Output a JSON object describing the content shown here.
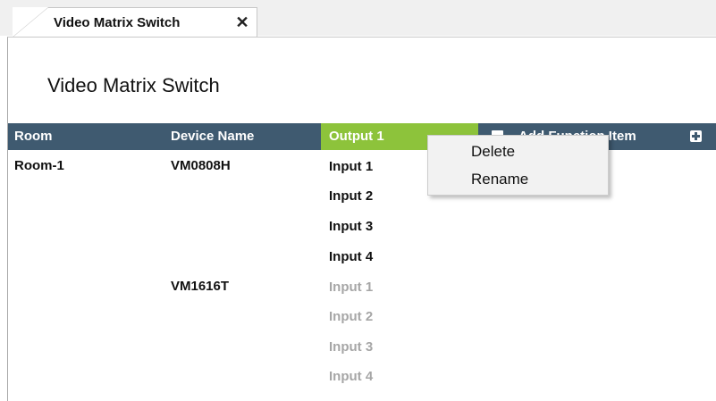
{
  "tab": {
    "title": "Video Matrix Switch",
    "close_glyph": "✕"
  },
  "page": {
    "title": "Video Matrix Switch"
  },
  "table": {
    "headers": {
      "room": "Room",
      "device_name": "Device Name",
      "output": "Output 1",
      "add_function": "Add Function Item"
    },
    "rooms": [
      {
        "room": "Room-1",
        "devices": [
          {
            "name": "VM0808H",
            "inputs": [
              "Input 1",
              "Input 2",
              "Input 3",
              "Input 4"
            ],
            "active": true
          },
          {
            "name": "VM1616T",
            "inputs": [
              "Input 1",
              "Input 2",
              "Input 3",
              "Input 4"
            ],
            "active": false
          }
        ]
      }
    ]
  },
  "context_menu": {
    "items": [
      "Delete",
      "Rename"
    ]
  },
  "colors": {
    "header_bg": "#3f5a70",
    "output_header_bg": "#8dc33b",
    "active_text": "#111111",
    "inactive_text": "#a6a6a6"
  }
}
